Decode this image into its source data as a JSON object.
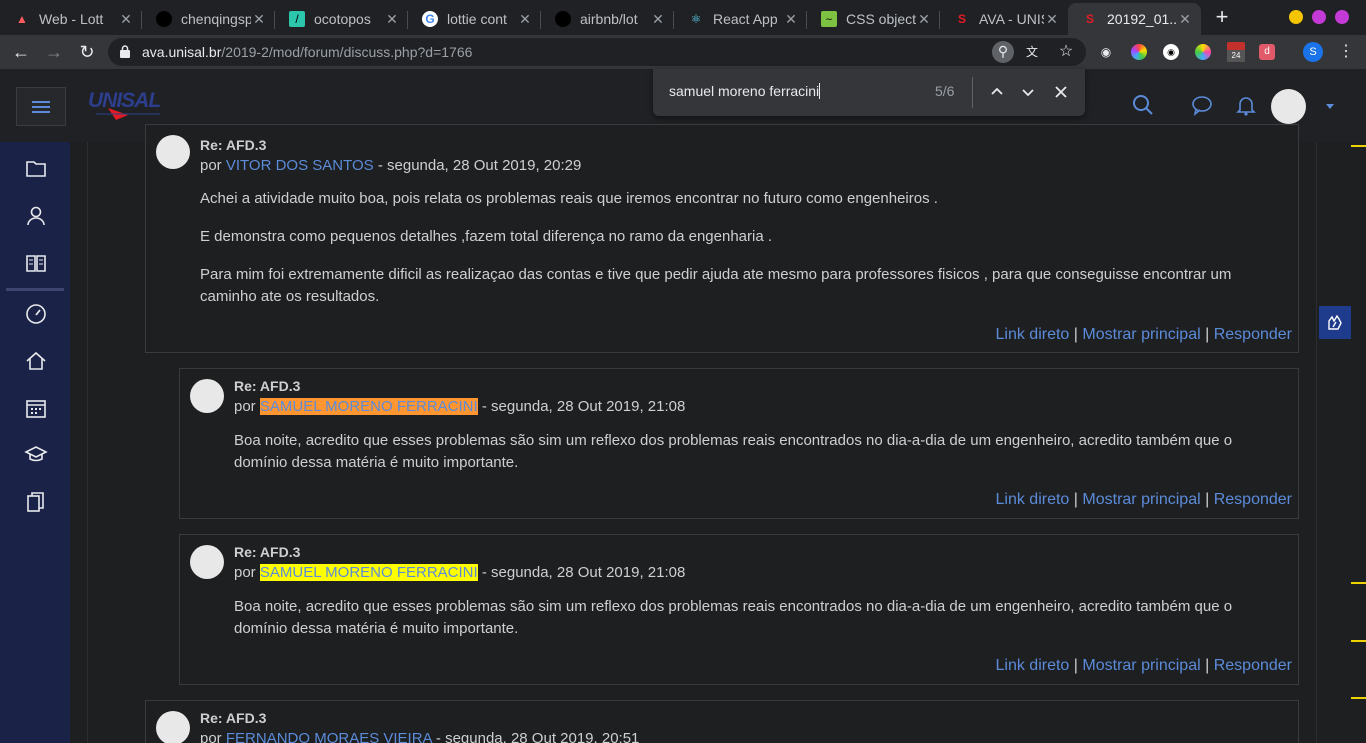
{
  "tabs": [
    {
      "title": "Web - Lott",
      "icon": "airbnb-icon",
      "color": "#ff5a5f"
    },
    {
      "title": "chenqingspo",
      "icon": "github-icon",
      "color": "#24292e"
    },
    {
      "title": "ocotopos",
      "icon": "codepen-icon",
      "color": "#2bc6ab"
    },
    {
      "title": "lottie cont",
      "icon": "google-icon",
      "color": "#4285f4"
    },
    {
      "title": "airbnb/lot",
      "icon": "github-icon",
      "color": "#24292e"
    },
    {
      "title": "React App",
      "icon": "react-icon",
      "color": "#61dafb"
    },
    {
      "title": "CSS object",
      "icon": "css-icon",
      "color": "#7ec242"
    },
    {
      "title": "AVA - UNIS",
      "icon": "unisal-icon",
      "color": "#e31b23"
    },
    {
      "title": "20192_01..",
      "icon": "unisal-icon",
      "color": "#e31b23"
    }
  ],
  "toolbar": {
    "url_host": "ava.unisal.br",
    "url_path": "/2019-2/mod/forum/discuss.php?d=1766",
    "extension_badge": "24"
  },
  "findbar": {
    "query": "samuel moreno ferracini",
    "count": "5/6"
  },
  "site": {
    "logo": "UNISAL",
    "accent": "#5b8bd9"
  },
  "commands": {
    "link": "Link direto",
    "parent": "Mostrar principal",
    "reply": "Responder",
    "sep": "|"
  },
  "posts": [
    {
      "subject": "Re: AFD.3",
      "by_prefix": "por",
      "author": "VITOR DOS SANTOS",
      "date": "- segunda, 28 Out 2019, 20:29",
      "paragraphs": [
        "Achei a atividade muito boa, pois relata os problemas reais que iremos encontrar no futuro como engenheiros .",
        "E demonstra como pequenos detalhes ,fazem total diferença no ramo da engenharia .",
        "Para mim foi extremamente dificil as realizaçao das contas e tive que pedir ajuda ate mesmo para professores fisicos , para que conseguisse encontrar um caminho ate os resultados."
      ]
    },
    {
      "subject": "Re: AFD.3",
      "by_prefix": "por",
      "author": "SAMUEL MORENO FERRACINI",
      "date": "- segunda, 28 Out 2019, 21:08",
      "paragraphs": [
        "Boa noite, acredito que esses problemas são sim um reflexo dos problemas reais encontrados no dia-a-dia de um engenheiro, acredito também que o domínio dessa matéria é muito importante."
      ]
    },
    {
      "subject": "Re: AFD.3",
      "by_prefix": "por",
      "author": "SAMUEL MORENO FERRACINI",
      "date": "- segunda, 28 Out 2019, 21:08",
      "paragraphs": [
        "Boa noite, acredito que esses problemas são sim um reflexo dos problemas reais encontrados no dia-a-dia de um engenheiro, acredito também que o domínio dessa matéria é muito importante."
      ]
    },
    {
      "subject": "Re: AFD.3",
      "by_prefix": "por",
      "author": "FERNANDO MORAES VIEIRA",
      "date": "- segunda, 28 Out 2019, 20:51"
    }
  ]
}
